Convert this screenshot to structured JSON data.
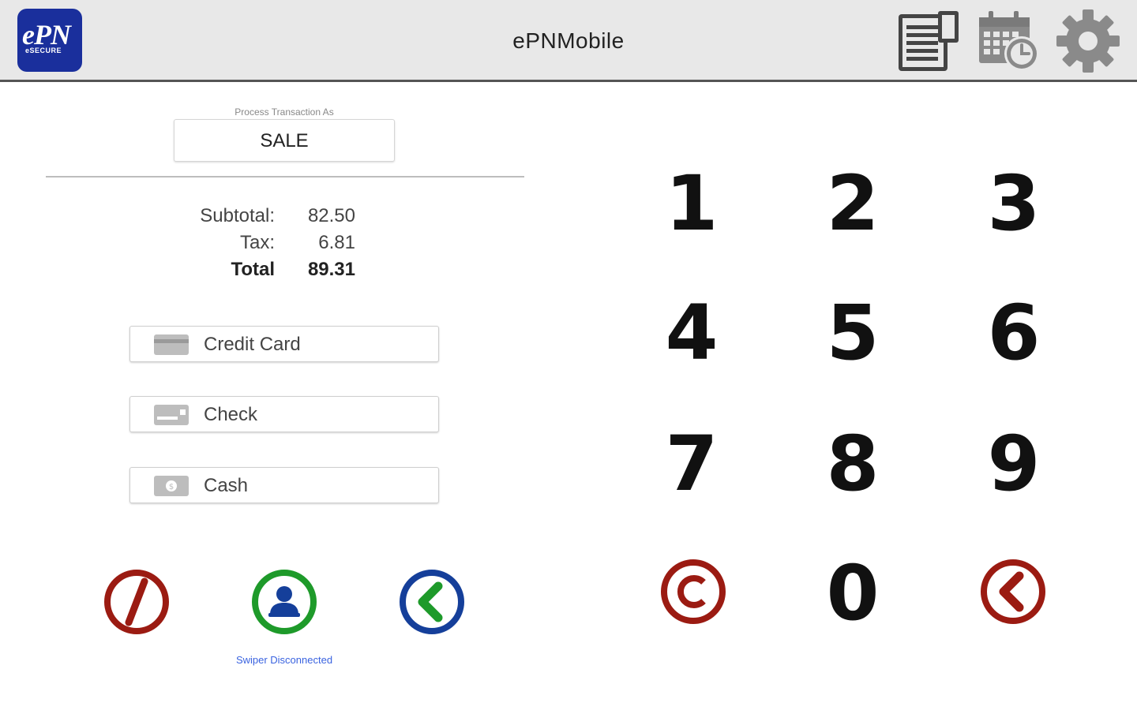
{
  "header": {
    "title": "ePNMobile",
    "logo": {
      "text": "ePN",
      "subtext": "eSECURE"
    },
    "icons": [
      "receipt-icon",
      "calendar-clock-icon",
      "gear-icon"
    ]
  },
  "transaction": {
    "label": "Process Transaction As",
    "type": "SALE"
  },
  "totals": {
    "subtotal_label": "Subtotal:",
    "subtotal_value": "82.50",
    "tax_label": "Tax:",
    "tax_value": "6.81",
    "total_label": "Total",
    "total_value": "89.31"
  },
  "payment_methods": [
    {
      "label": "Credit Card",
      "icon": "credit-card-icon"
    },
    {
      "label": "Check",
      "icon": "check-icon"
    },
    {
      "label": "Cash",
      "icon": "cash-icon"
    }
  ],
  "actions": {
    "void_icon": "void-icon",
    "customer_icon": "customer-icon",
    "back_icon": "back-arrow-icon",
    "swiper_status": "Swiper Disconnected"
  },
  "keypad": {
    "keys": [
      "1",
      "2",
      "3",
      "4",
      "5",
      "6",
      "7",
      "8",
      "9",
      "0"
    ],
    "clear_icon": "clear-icon",
    "backspace_icon": "backspace-icon"
  },
  "colors": {
    "header_bg": "#e8e8e8",
    "logo_bg": "#1a2f9c",
    "void_red": "#9b1b12",
    "customer_green": "#1e9a2a",
    "back_blue": "#153f9a",
    "status_blue": "#3a63e0"
  }
}
